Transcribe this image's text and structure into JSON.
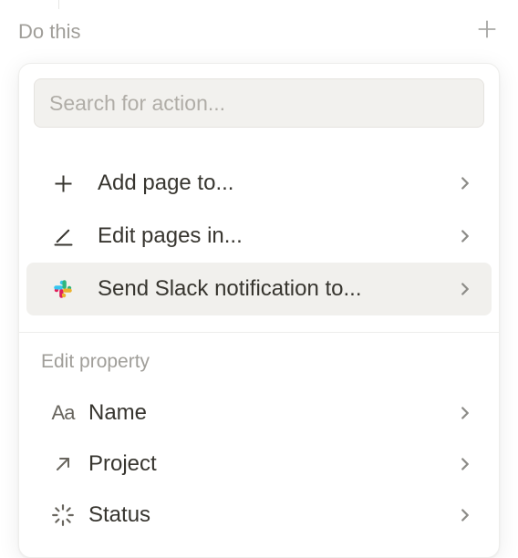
{
  "header": {
    "label": "Do this"
  },
  "search": {
    "placeholder": "Search for action..."
  },
  "actions": [
    {
      "id": "add-page",
      "label": "Add page to...",
      "icon": "plus",
      "highlighted": false
    },
    {
      "id": "edit-pages",
      "label": "Edit pages in...",
      "icon": "edit",
      "highlighted": false
    },
    {
      "id": "slack",
      "label": "Send Slack notification to...",
      "icon": "slack",
      "highlighted": true
    }
  ],
  "section": {
    "title": "Edit property"
  },
  "properties": [
    {
      "id": "name",
      "label": "Name",
      "icon": "text"
    },
    {
      "id": "project",
      "label": "Project",
      "icon": "arrow-up-right"
    },
    {
      "id": "status",
      "label": "Status",
      "icon": "loader"
    }
  ]
}
